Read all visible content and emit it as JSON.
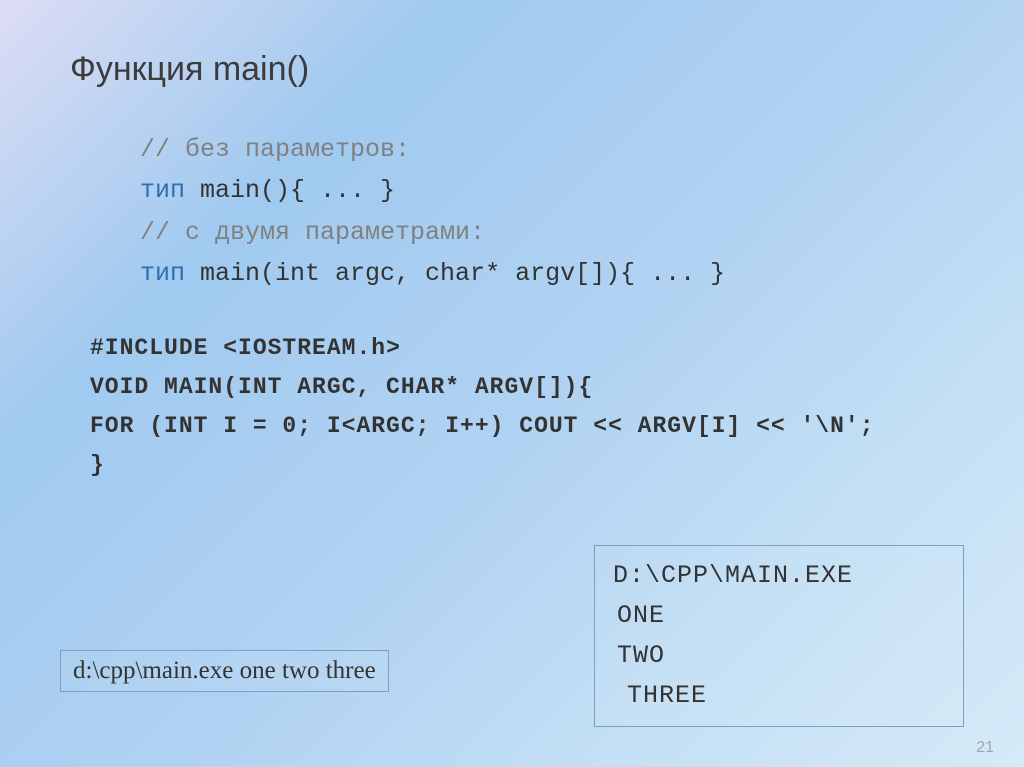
{
  "title": "Функция main()",
  "block1": {
    "l1": "// без параметров:",
    "l2_kw": "тип",
    "l2_rest": " main(){ ... }",
    "l3": "// с двумя параметрами:",
    "l4_kw": "тип",
    "l4_rest": " main(int argc, char* argv[]){ ... }"
  },
  "block2": {
    "l1a": "#INCLUDE <IOSTREAM.",
    "l1b": "h",
    "l1c": ">",
    "l2": "VOID MAIN(INT ARGC, CHAR* ARGV[]){",
    "l3": "FOR (INT I = 0; I<ARGC; I++) COUT << ARGV[I] << '\\n';",
    "l4": "}"
  },
  "input_box": "d:\\cpp\\main.exe one two three",
  "output_box": {
    "l1": "D:\\CPP\\MAIN.EXE",
    "l2": "ONE",
    "l3": "TWO",
    "l4": "THREE"
  },
  "page": "21"
}
